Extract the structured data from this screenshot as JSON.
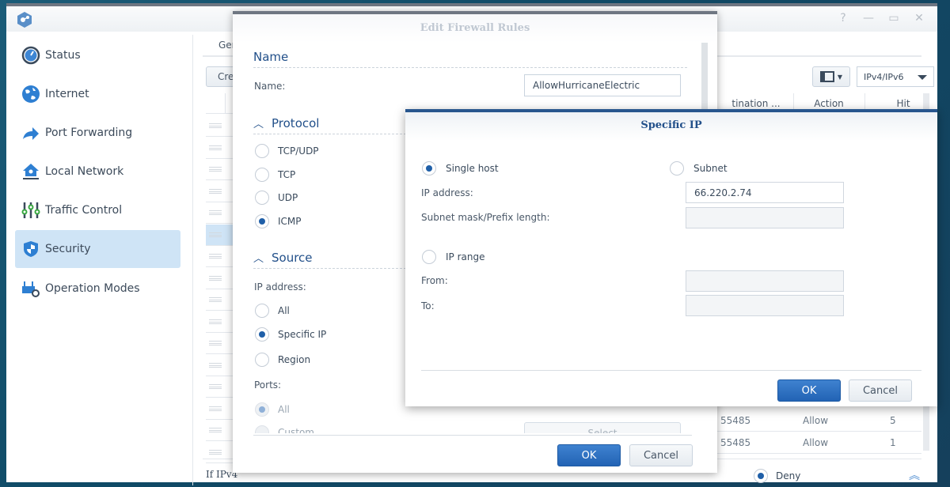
{
  "app": {
    "window_controls": [
      "help",
      "minimize",
      "maximize",
      "close"
    ]
  },
  "sidebar": {
    "items": [
      {
        "label": "Status",
        "icon": "gauge-icon",
        "active": false
      },
      {
        "label": "Internet",
        "icon": "globe-icon",
        "active": false
      },
      {
        "label": "Port Forwarding",
        "icon": "forward-arrow-icon",
        "active": false
      },
      {
        "label": "Local Network",
        "icon": "home-network-icon",
        "active": false
      },
      {
        "label": "Traffic Control",
        "icon": "sliders-icon",
        "active": false
      },
      {
        "label": "Security",
        "icon": "shield-icon",
        "active": true
      },
      {
        "label": "Operation Modes",
        "icon": "router-gear-icon",
        "active": false
      }
    ]
  },
  "main": {
    "tab_general_partial": "Ger",
    "create_button_partial": "Cre",
    "ip_version_select": "IPv4/IPv6",
    "columns": [
      "tination ...",
      "Action",
      "Hit"
    ],
    "visible_rows": [
      {
        "destination": "55485",
        "action": "Allow",
        "hit": "5"
      },
      {
        "destination": "55485",
        "action": "Allow",
        "hit": "1"
      }
    ],
    "footer_text_partial": "If IPv4",
    "default_action": "Deny"
  },
  "firewall_dialog": {
    "title": "Edit Firewall Rules",
    "name_section": "Name",
    "name_label": "Name:",
    "name_value": "AllowHurricaneElectric",
    "protocol_section": "Protocol",
    "protocols": [
      {
        "label": "TCP/UDP",
        "checked": false
      },
      {
        "label": "TCP",
        "checked": false
      },
      {
        "label": "UDP",
        "checked": false
      },
      {
        "label": "ICMP",
        "checked": true
      }
    ],
    "source_section": "Source",
    "ip_address_label": "IP address:",
    "source_options": [
      {
        "label": "All",
        "checked": false
      },
      {
        "label": "Specific IP",
        "checked": true
      },
      {
        "label": "Region",
        "checked": false
      }
    ],
    "ports_label": "Ports:",
    "port_options": [
      {
        "label": "All",
        "checked": true,
        "disabled": true
      },
      {
        "label": "Custom",
        "checked": false,
        "disabled": true
      }
    ],
    "select_button": "Select",
    "ok_button": "OK",
    "cancel_button": "Cancel"
  },
  "specific_ip_dialog": {
    "title": "Specific IP",
    "single_host_label": "Single host",
    "single_host_checked": true,
    "subnet_label": "Subnet",
    "subnet_checked": false,
    "ip_address_label": "IP address:",
    "ip_address_value": "66.220.2.74",
    "subnet_mask_label": "Subnet mask/Prefix length:",
    "subnet_mask_value": "",
    "ip_range_label": "IP range",
    "ip_range_checked": false,
    "from_label": "From:",
    "from_value": "",
    "to_label": "To:",
    "to_value": "",
    "ok_button": "OK",
    "cancel_button": "Cancel"
  }
}
